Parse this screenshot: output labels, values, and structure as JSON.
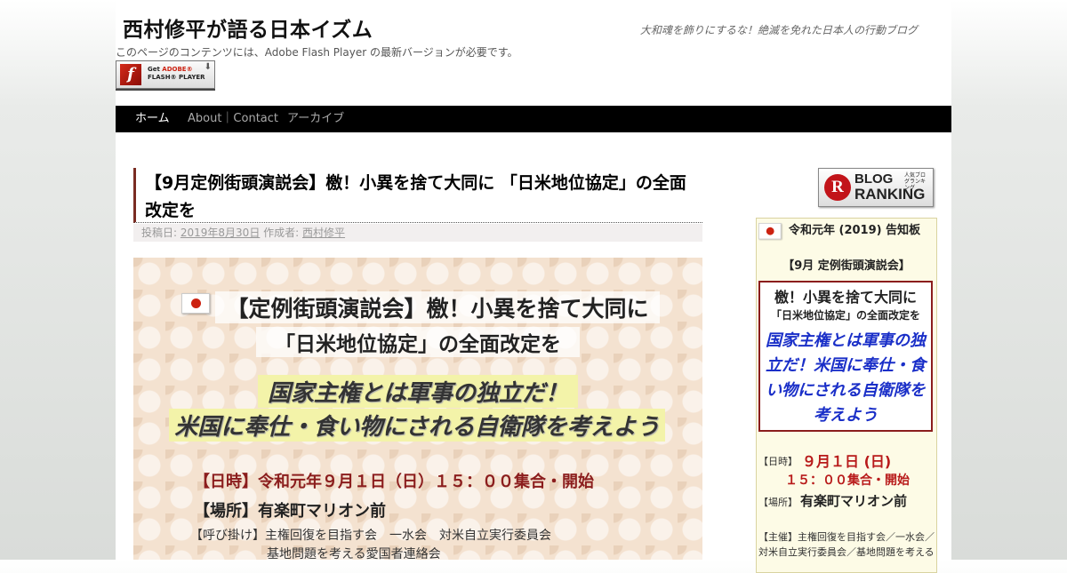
{
  "header": {
    "site_title": "西村修平が語る日本イズム",
    "site_description": "大和魂を飾りにするな！絶滅を免れた日本人の行動ブログ",
    "flash_notice": "このページのコンテンツには、Adobe Flash Player の最新バージョンが必要です。",
    "flash_badge": {
      "line1_prefix": "Get ",
      "line1_brand": "ADOBE®",
      "line2": "FLASH® PLAYER",
      "icon": "flash-f-icon"
    }
  },
  "nav": {
    "items": [
      {
        "label": "ホーム",
        "active": true
      },
      {
        "label": "About｜Contact",
        "active": false
      },
      {
        "label": "アーカイブ",
        "active": false
      }
    ]
  },
  "post": {
    "title": "【9月定例街頭演説会】檄！小異を捨て大同に 「日米地位協定」の全面改定を",
    "meta": {
      "posted_label": "投稿日:",
      "date": "2019年8月30日",
      "author_label": "作成者:",
      "author": "西村修平"
    },
    "poster": {
      "heading1": "【定例街頭演説会】檄！小異を捨て大同に",
      "heading2": "「日米地位協定」の全面改定を",
      "emphasis1": "国家主権とは軍事の独立だ！",
      "emphasis2": "米国に奉仕・食い物にされる自衛隊を考えよう",
      "datetime": "【日時】令和元年９月１日（日）１５：００集合・開始",
      "place": "【場所】有楽町マリオン前",
      "organizers_line1": "【呼び掛け】主権回復を目指す会　一水会　対米自立実行委員会",
      "organizers_line2": "基地問題を考える愛国者連絡会"
    }
  },
  "sidebar": {
    "ranking": {
      "word1": "BLOG",
      "small": "人気ブログランキング",
      "word2": "RANKING"
    },
    "notice": {
      "heading": "令和元年 (2019) 告知板",
      "subheading": "【9月 定例街頭演説会】",
      "box_line1": "檄！小異を捨て大同に",
      "box_line2": "「日米地位協定」の全面改定を",
      "box_slogan": "国家主権とは軍事の独立だ！米国に奉仕・食い物にされる自衛隊を考えよう",
      "date_label": "【日時】",
      "date_value": "９月１日 (日)",
      "time_value": "１５：００集合・開始",
      "place_label": "【場所】",
      "place_value": "有楽町マリオン前",
      "organizers_line1": "【主催】主権回復を目指す会／一水会／",
      "organizers_line2": "対米自立実行委員会／基地問題を考える"
    }
  },
  "colors": {
    "nav_bg": "#000000",
    "title_accent": "#7a2c22",
    "event_red": "#8b1d1d",
    "slogan_blue": "#1a2fc8",
    "highlight_yellow": "#f3f3a9"
  }
}
